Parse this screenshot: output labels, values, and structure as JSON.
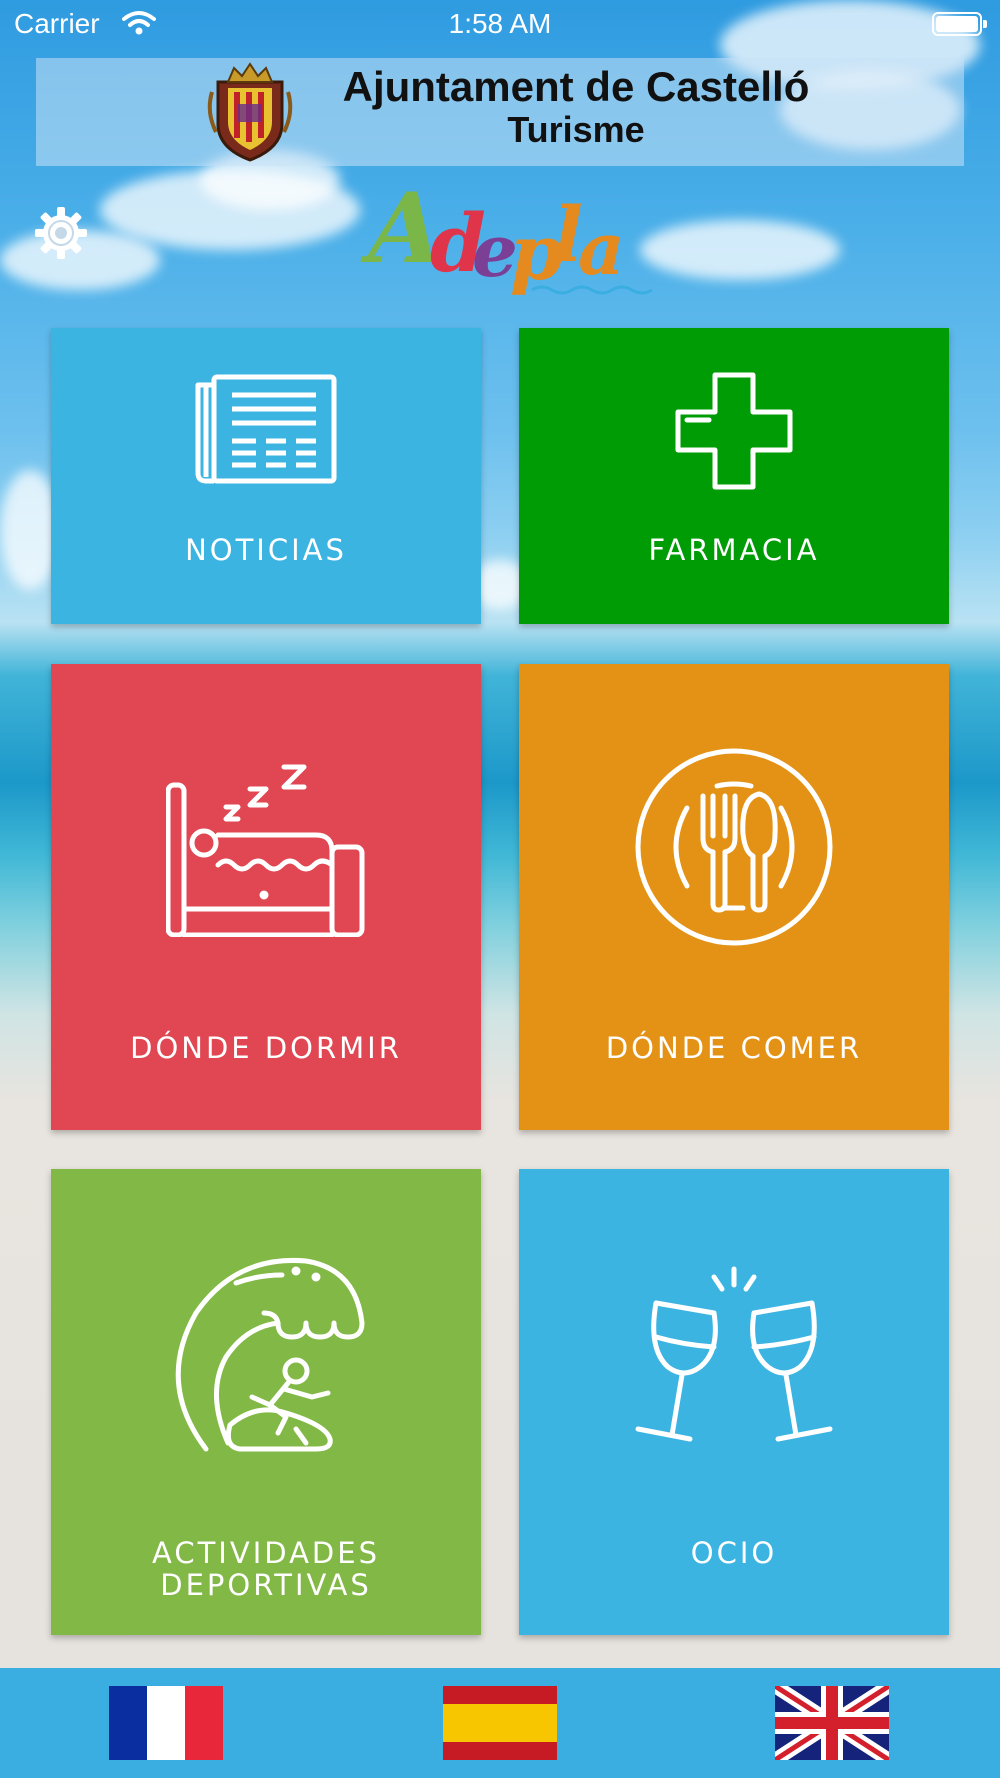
{
  "status_bar": {
    "carrier": "Carrier",
    "time": "1:58 AM"
  },
  "header": {
    "title_line1": "Ajuntament de Castelló",
    "title_line2": "Turisme",
    "crest_icon": "castello-coat-of-arms"
  },
  "logo": {
    "letters": [
      "A",
      "d",
      "e",
      "p",
      "l",
      "a"
    ],
    "colors": [
      "#7ab648",
      "#e0344a",
      "#7b3f96",
      "#e58a1f",
      "#e58a1f",
      "#e58a1f"
    ]
  },
  "settings": {
    "icon": "gear-icon"
  },
  "tiles": [
    {
      "label": "NOTICIAS",
      "icon": "newspaper-icon",
      "color": "#3cb4e2"
    },
    {
      "label": "FARMACIA",
      "icon": "pharmacy-cross-icon",
      "color": "#009c06"
    },
    {
      "label": "DÓNDE DORMIR",
      "icon": "bed-icon",
      "color": "#e04752"
    },
    {
      "label": "DÓNDE COMER",
      "icon": "plate-cutlery-icon",
      "color": "#e39216"
    },
    {
      "label_line1": "ACTIVIDADES",
      "label_line2": "DEPORTIVAS",
      "icon": "surf-wave-icon",
      "color": "#82b845"
    },
    {
      "label": "OCIO",
      "icon": "wine-glasses-icon",
      "color": "#3cb4e2"
    }
  ],
  "languages": [
    {
      "icon": "france-flag-icon"
    },
    {
      "icon": "spain-flag-icon"
    },
    {
      "icon": "uk-flag-icon"
    }
  ],
  "bottom_bar_color": "#3aaee0"
}
